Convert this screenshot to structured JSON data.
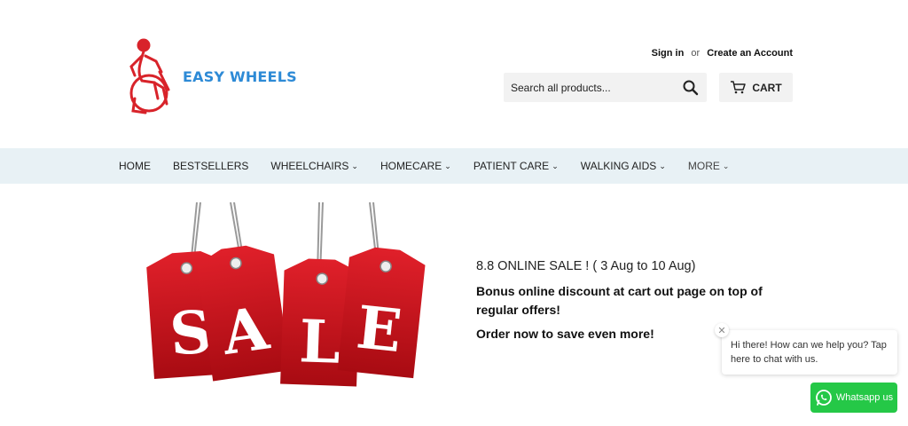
{
  "brand": {
    "name": "EASY WHEELS",
    "text_color": "#2d8ad6",
    "logo_color": "#d8232a"
  },
  "account": {
    "sign_in": "Sign in",
    "or": "or",
    "create_account": "Create an Account"
  },
  "search": {
    "placeholder": "Search all products..."
  },
  "cart": {
    "label": "CART"
  },
  "nav": {
    "items": [
      {
        "label": "HOME",
        "dropdown": false
      },
      {
        "label": "BESTSELLERS",
        "dropdown": false
      },
      {
        "label": "WHEELCHAIRS",
        "dropdown": true
      },
      {
        "label": "HOMECARE",
        "dropdown": true
      },
      {
        "label": "PATIENT CARE",
        "dropdown": true
      },
      {
        "label": "WALKING AIDS",
        "dropdown": true
      },
      {
        "label": "MORE",
        "dropdown": true
      }
    ],
    "background": "#e8f1f5"
  },
  "banner": {
    "tag_letters": [
      "S",
      "A",
      "L",
      "E"
    ],
    "tag_color": "#c8111a"
  },
  "promo": {
    "headline": "8.8 ONLINE SALE ! ( 3 Aug to 10 Aug)",
    "bonus": "Bonus online discount at cart out page on top of regular offers!",
    "order": "Order now to save even more!"
  },
  "chat": {
    "message": "Hi there! How can we help you? Tap here to chat with us.",
    "close_icon": "close-icon",
    "button_label": "Whatsapp us",
    "button_color": "#25c847"
  }
}
